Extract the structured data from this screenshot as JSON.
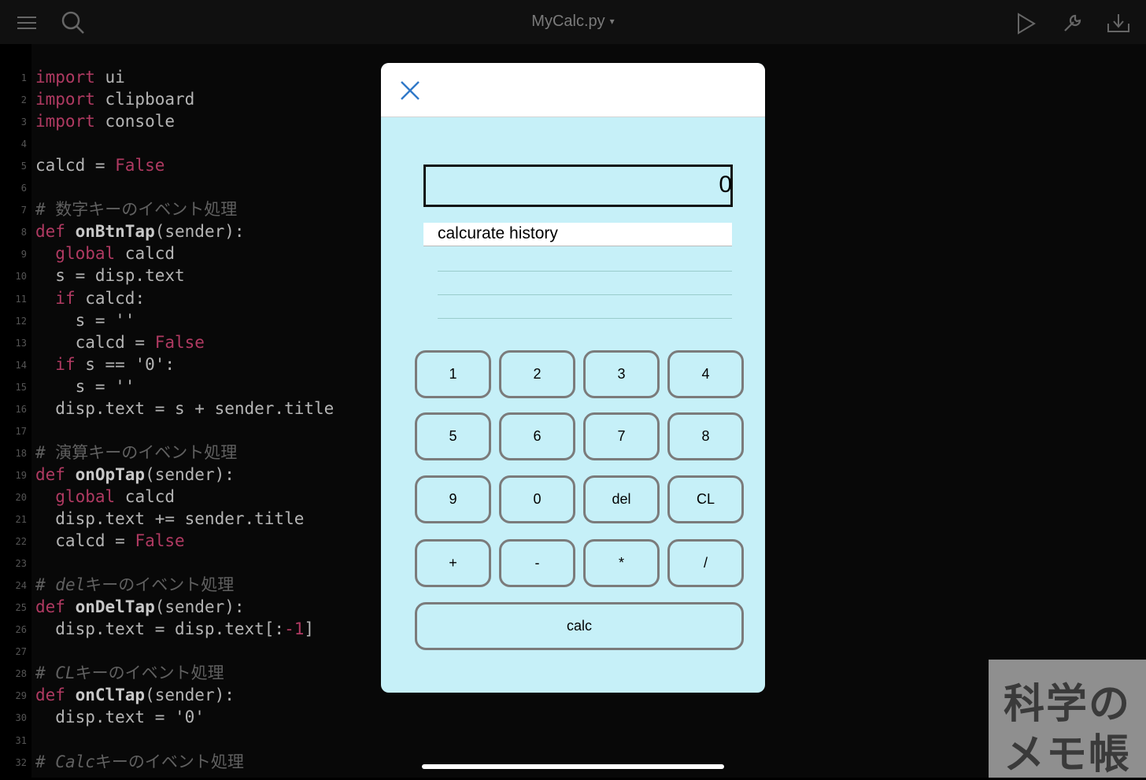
{
  "toolbar": {
    "title": "MyCalc.py",
    "title_caret": "▾",
    "icons": [
      "menu-icon",
      "search-icon",
      "play-icon",
      "wrench-icon",
      "export-icon"
    ]
  },
  "code": {
    "lines": [
      {
        "n": "1",
        "parts": [
          [
            "kw",
            "import"
          ],
          [
            "nm",
            " ui"
          ]
        ]
      },
      {
        "n": "2",
        "parts": [
          [
            "kw",
            "import"
          ],
          [
            "nm",
            " clipboard"
          ]
        ]
      },
      {
        "n": "3",
        "parts": [
          [
            "kw",
            "import"
          ],
          [
            "nm",
            " console"
          ]
        ]
      },
      {
        "n": "4",
        "parts": []
      },
      {
        "n": "5",
        "parts": [
          [
            "nm",
            "calcd = "
          ],
          [
            "kw",
            "False"
          ]
        ]
      },
      {
        "n": "6",
        "parts": []
      },
      {
        "n": "7",
        "parts": [
          [
            "cm",
            "# 数字キーのイベント処理"
          ]
        ]
      },
      {
        "n": "8",
        "parts": [
          [
            "kw",
            "def "
          ],
          [
            "fn",
            "onBtnTap"
          ],
          [
            "nm",
            "(sender):"
          ]
        ]
      },
      {
        "n": "9",
        "parts": [
          [
            "nm",
            "  "
          ],
          [
            "kw",
            "global"
          ],
          [
            "nm",
            " calcd"
          ]
        ]
      },
      {
        "n": "10",
        "parts": [
          [
            "nm",
            "  s = disp.text"
          ]
        ]
      },
      {
        "n": "11",
        "parts": [
          [
            "nm",
            "  "
          ],
          [
            "kw",
            "if"
          ],
          [
            "nm",
            " calcd:"
          ]
        ]
      },
      {
        "n": "12",
        "parts": [
          [
            "nm",
            "    s = ''"
          ]
        ]
      },
      {
        "n": "13",
        "parts": [
          [
            "nm",
            "    calcd = "
          ],
          [
            "kw",
            "False"
          ]
        ]
      },
      {
        "n": "14",
        "parts": [
          [
            "nm",
            "  "
          ],
          [
            "kw",
            "if"
          ],
          [
            "nm",
            " s == '0':"
          ]
        ]
      },
      {
        "n": "15",
        "parts": [
          [
            "nm",
            "    s = ''"
          ]
        ]
      },
      {
        "n": "16",
        "parts": [
          [
            "nm",
            "  disp.text = s + sender.title"
          ]
        ]
      },
      {
        "n": "17",
        "parts": []
      },
      {
        "n": "18",
        "parts": [
          [
            "cm",
            "# 演算キーのイベント処理"
          ]
        ]
      },
      {
        "n": "19",
        "parts": [
          [
            "kw",
            "def "
          ],
          [
            "fn",
            "onOpTap"
          ],
          [
            "nm",
            "(sender):"
          ]
        ]
      },
      {
        "n": "20",
        "parts": [
          [
            "nm",
            "  "
          ],
          [
            "kw",
            "global"
          ],
          [
            "nm",
            " calcd"
          ]
        ]
      },
      {
        "n": "21",
        "parts": [
          [
            "nm",
            "  disp.text += sender.title"
          ]
        ]
      },
      {
        "n": "22",
        "parts": [
          [
            "nm",
            "  calcd = "
          ],
          [
            "kw",
            "False"
          ]
        ]
      },
      {
        "n": "23",
        "parts": []
      },
      {
        "n": "24",
        "parts": [
          [
            "cm",
            "# "
          ],
          [
            "cmi",
            "del"
          ],
          [
            "cm",
            "キーのイベント処理"
          ]
        ]
      },
      {
        "n": "25",
        "parts": [
          [
            "kw",
            "def "
          ],
          [
            "fn",
            "onDelTap"
          ],
          [
            "nm",
            "(sender):"
          ]
        ]
      },
      {
        "n": "26",
        "parts": [
          [
            "nm",
            "  disp.text = disp.text[:"
          ],
          [
            "num",
            "-1"
          ],
          [
            "nm",
            "]"
          ]
        ]
      },
      {
        "n": "27",
        "parts": []
      },
      {
        "n": "28",
        "parts": [
          [
            "cm",
            "# "
          ],
          [
            "cmi",
            "CL"
          ],
          [
            "cm",
            "キーのイベント処理"
          ]
        ]
      },
      {
        "n": "29",
        "parts": [
          [
            "kw",
            "def "
          ],
          [
            "fn",
            "onClTap"
          ],
          [
            "nm",
            "(sender):"
          ]
        ]
      },
      {
        "n": "30",
        "parts": [
          [
            "nm",
            "  disp.text = '0'"
          ]
        ]
      },
      {
        "n": "31",
        "parts": []
      },
      {
        "n": "32",
        "parts": [
          [
            "cm",
            "# "
          ],
          [
            "cmi",
            "Calc"
          ],
          [
            "cm",
            "キーのイベント処理"
          ]
        ]
      }
    ]
  },
  "dialog": {
    "display_value": "0",
    "history_title": "calcurate history",
    "keys": [
      [
        "1",
        "2",
        "3",
        "4"
      ],
      [
        "5",
        "6",
        "7",
        "8"
      ],
      [
        "9",
        "0",
        "del",
        "CL"
      ],
      [
        "+",
        "-",
        "*",
        "/"
      ]
    ],
    "calc_label": "calc"
  },
  "watermark": {
    "line1": "科学の",
    "line2": "メモ帳"
  },
  "colors": {
    "dialog_bg": "#c6f0f8",
    "keyword": "#b03a62",
    "close_icon": "#2f78c8"
  }
}
